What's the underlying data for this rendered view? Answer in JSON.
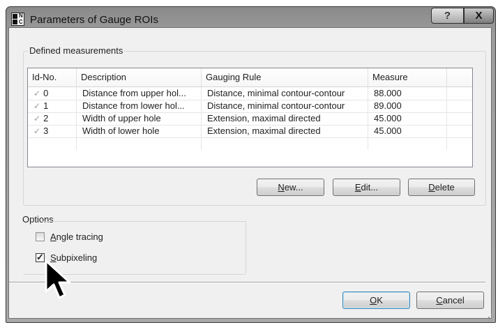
{
  "window": {
    "title": "Parameters of Gauge ROIs",
    "icon_letters": [
      "N",
      "C"
    ],
    "help_label": "?",
    "close_label": "X"
  },
  "measurements": {
    "caption": "Defined measurements",
    "columns": [
      "Id-No.",
      "Description",
      "Gauging Rule",
      "Measure"
    ],
    "rows": [
      {
        "check": "✓",
        "id": "0",
        "description": "Distance from upper hol...",
        "rule": "Distance, minimal contour-contour",
        "measure": "88.000"
      },
      {
        "check": "✓",
        "id": "1",
        "description": "Distance from lower hol...",
        "rule": "Distance, minimal contour-contour",
        "measure": "89.000"
      },
      {
        "check": "✓",
        "id": "2",
        "description": "Width of upper hole",
        "rule": "Extension, maximal directed",
        "measure": "45.000"
      },
      {
        "check": "✓",
        "id": "3",
        "description": "Width of lower hole",
        "rule": "Extension, maximal directed",
        "measure": "45.000"
      }
    ],
    "new_button": {
      "mnemonic": "N",
      "rest": "ew..."
    },
    "edit_button": {
      "mnemonic": "E",
      "rest": "dit..."
    },
    "delete_button": {
      "mnemonic": "D",
      "rest": "elete"
    }
  },
  "options": {
    "caption": "Options",
    "angle_tracing": {
      "mnemonic": "A",
      "rest": "ngle tracing",
      "checked": false
    },
    "subpixeling": {
      "mnemonic": "S",
      "rest": "ubpixeling",
      "checked": true,
      "check_mark": "✓"
    }
  },
  "footer": {
    "ok_button": {
      "mnemonic": "O",
      "rest": "K"
    },
    "cancel_button": {
      "mnemonic": "C",
      "rest": "ancel"
    }
  }
}
